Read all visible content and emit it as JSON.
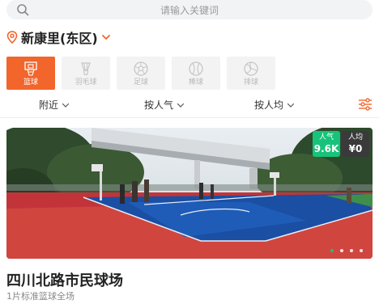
{
  "search": {
    "placeholder": "请输入关键词"
  },
  "location": {
    "name": "新康里(东区)"
  },
  "colors": {
    "accent": "#f2652b",
    "green": "#17c37a",
    "dark_badge": "#3a3a3a"
  },
  "sports": [
    {
      "label": "篮球",
      "icon": "basketball-icon",
      "active": true
    },
    {
      "label": "羽毛球",
      "icon": "badminton-icon",
      "active": false
    },
    {
      "label": "足球",
      "icon": "football-icon",
      "active": false
    },
    {
      "label": "棒球",
      "icon": "baseball-icon",
      "active": false
    },
    {
      "label": "排球",
      "icon": "volleyball-icon",
      "active": false
    }
  ],
  "filters": {
    "nearby": "附近",
    "popularity": "按人气",
    "avg_price": "按人均"
  },
  "venue": {
    "badges": {
      "popularity_label": "人气",
      "popularity_value": "9.6K",
      "avg_label": "人均",
      "avg_value": "¥0"
    },
    "carousel": {
      "count": 4,
      "active": 1
    },
    "name": "四川北路市民球场",
    "desc": "1片标准篮球全场"
  }
}
